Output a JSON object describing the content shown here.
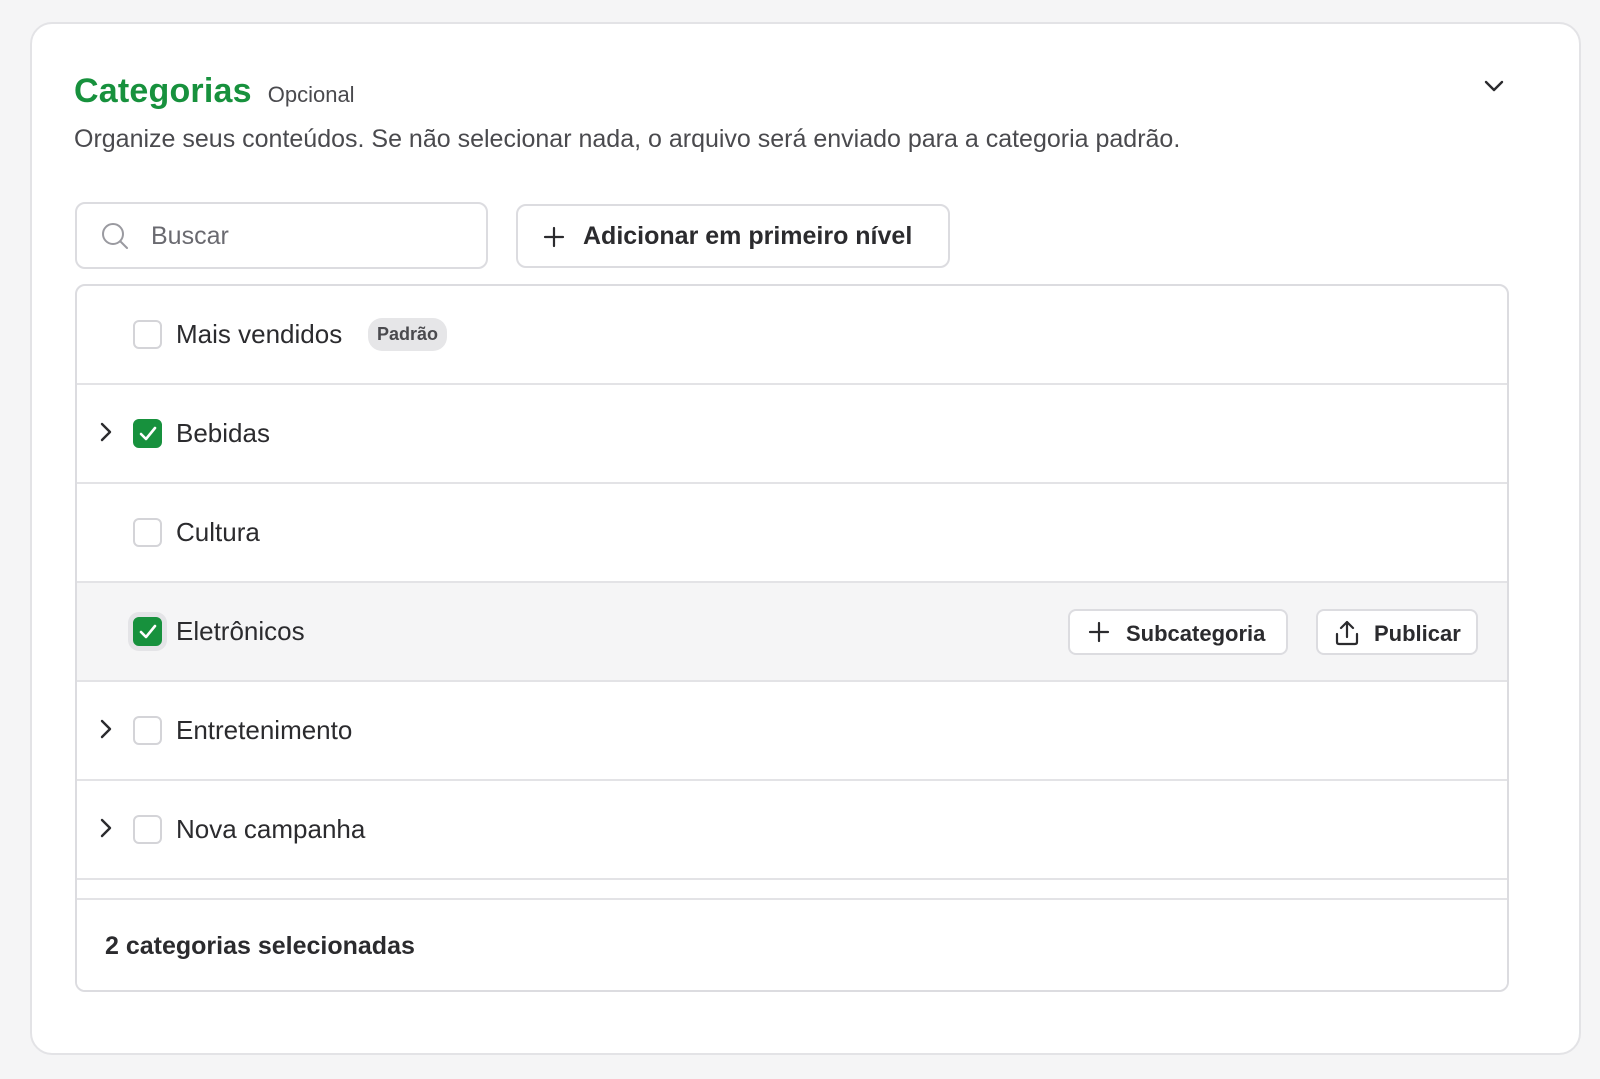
{
  "section": {
    "title": "Categorias",
    "optional_label": "Opcional",
    "description": "Organize seus conteúdos. Se não selecionar nada, o arquivo será enviado para a categoria padrão."
  },
  "search": {
    "placeholder": "Buscar",
    "value": ""
  },
  "add_root_button": {
    "label": "Adicionar em primeiro nível"
  },
  "categories": [
    {
      "label": "Mais vendidos",
      "checked": false,
      "expandable": false,
      "badge": "Padrão"
    },
    {
      "label": "Bebidas",
      "checked": true,
      "expandable": true
    },
    {
      "label": "Cultura",
      "checked": false,
      "expandable": false
    },
    {
      "label": "Eletrônicos",
      "checked": true,
      "expandable": false,
      "hovered": true,
      "actions": {
        "subcategory_label": "Subcategoria",
        "publish_label": "Publicar"
      }
    },
    {
      "label": "Entretenimento",
      "checked": false,
      "expandable": true
    },
    {
      "label": "Nova campanha",
      "checked": false,
      "expandable": true
    }
  ],
  "footer": {
    "selected_count_text": "2 categorias selecionadas"
  },
  "colors": {
    "accent": "#17913d",
    "border": "#dcdce0",
    "hover_row": "#f5f5f6"
  },
  "icons": [
    "search-icon",
    "plus-icon",
    "chevron-down-icon",
    "chevron-right-icon",
    "checkmark-icon",
    "upload-icon"
  ]
}
